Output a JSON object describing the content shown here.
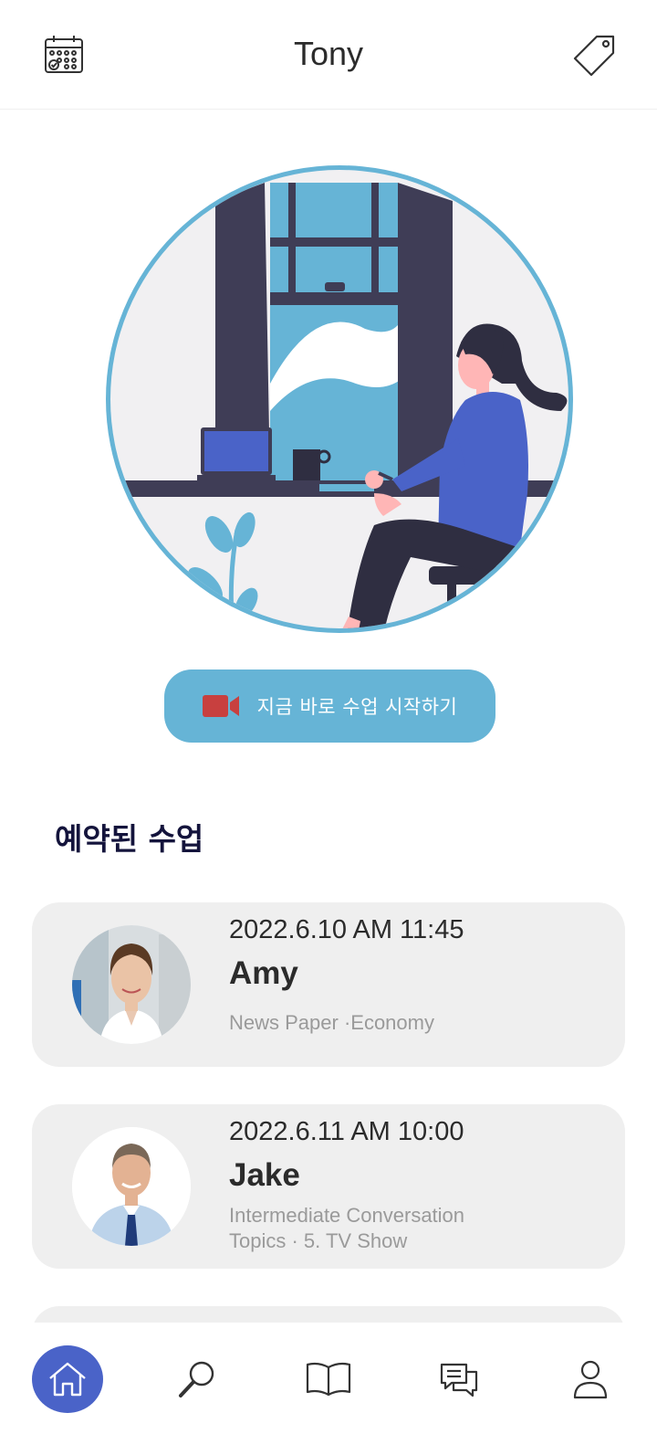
{
  "header": {
    "title": "Tony",
    "left_icon": "calendar-icon",
    "right_icon": "tag-icon"
  },
  "hero": {
    "illustration": "woman-working-at-window-illustration",
    "accent_color": "#66b4d6"
  },
  "start_button": {
    "label": "지금 바로 수업 시작하기",
    "icon": "video-camera-icon",
    "color": "#66b4d6",
    "icon_color": "#c8403f"
  },
  "section": {
    "title": "예약된 수업"
  },
  "lessons": [
    {
      "datetime": "2022.6.10 AM 11:45",
      "tutor": "Amy",
      "topic": "News Paper ·Economy"
    },
    {
      "datetime": "2022.6.11 AM 10:00",
      "tutor": "Jake",
      "topic_line1": "Intermediate Conversation",
      "topic_line2": "Topics · 5. TV Show"
    }
  ],
  "tabbar": {
    "active_color": "#4a63c8",
    "items": [
      "home-icon",
      "search-icon",
      "book-icon",
      "chat-icon",
      "profile-icon"
    ]
  }
}
